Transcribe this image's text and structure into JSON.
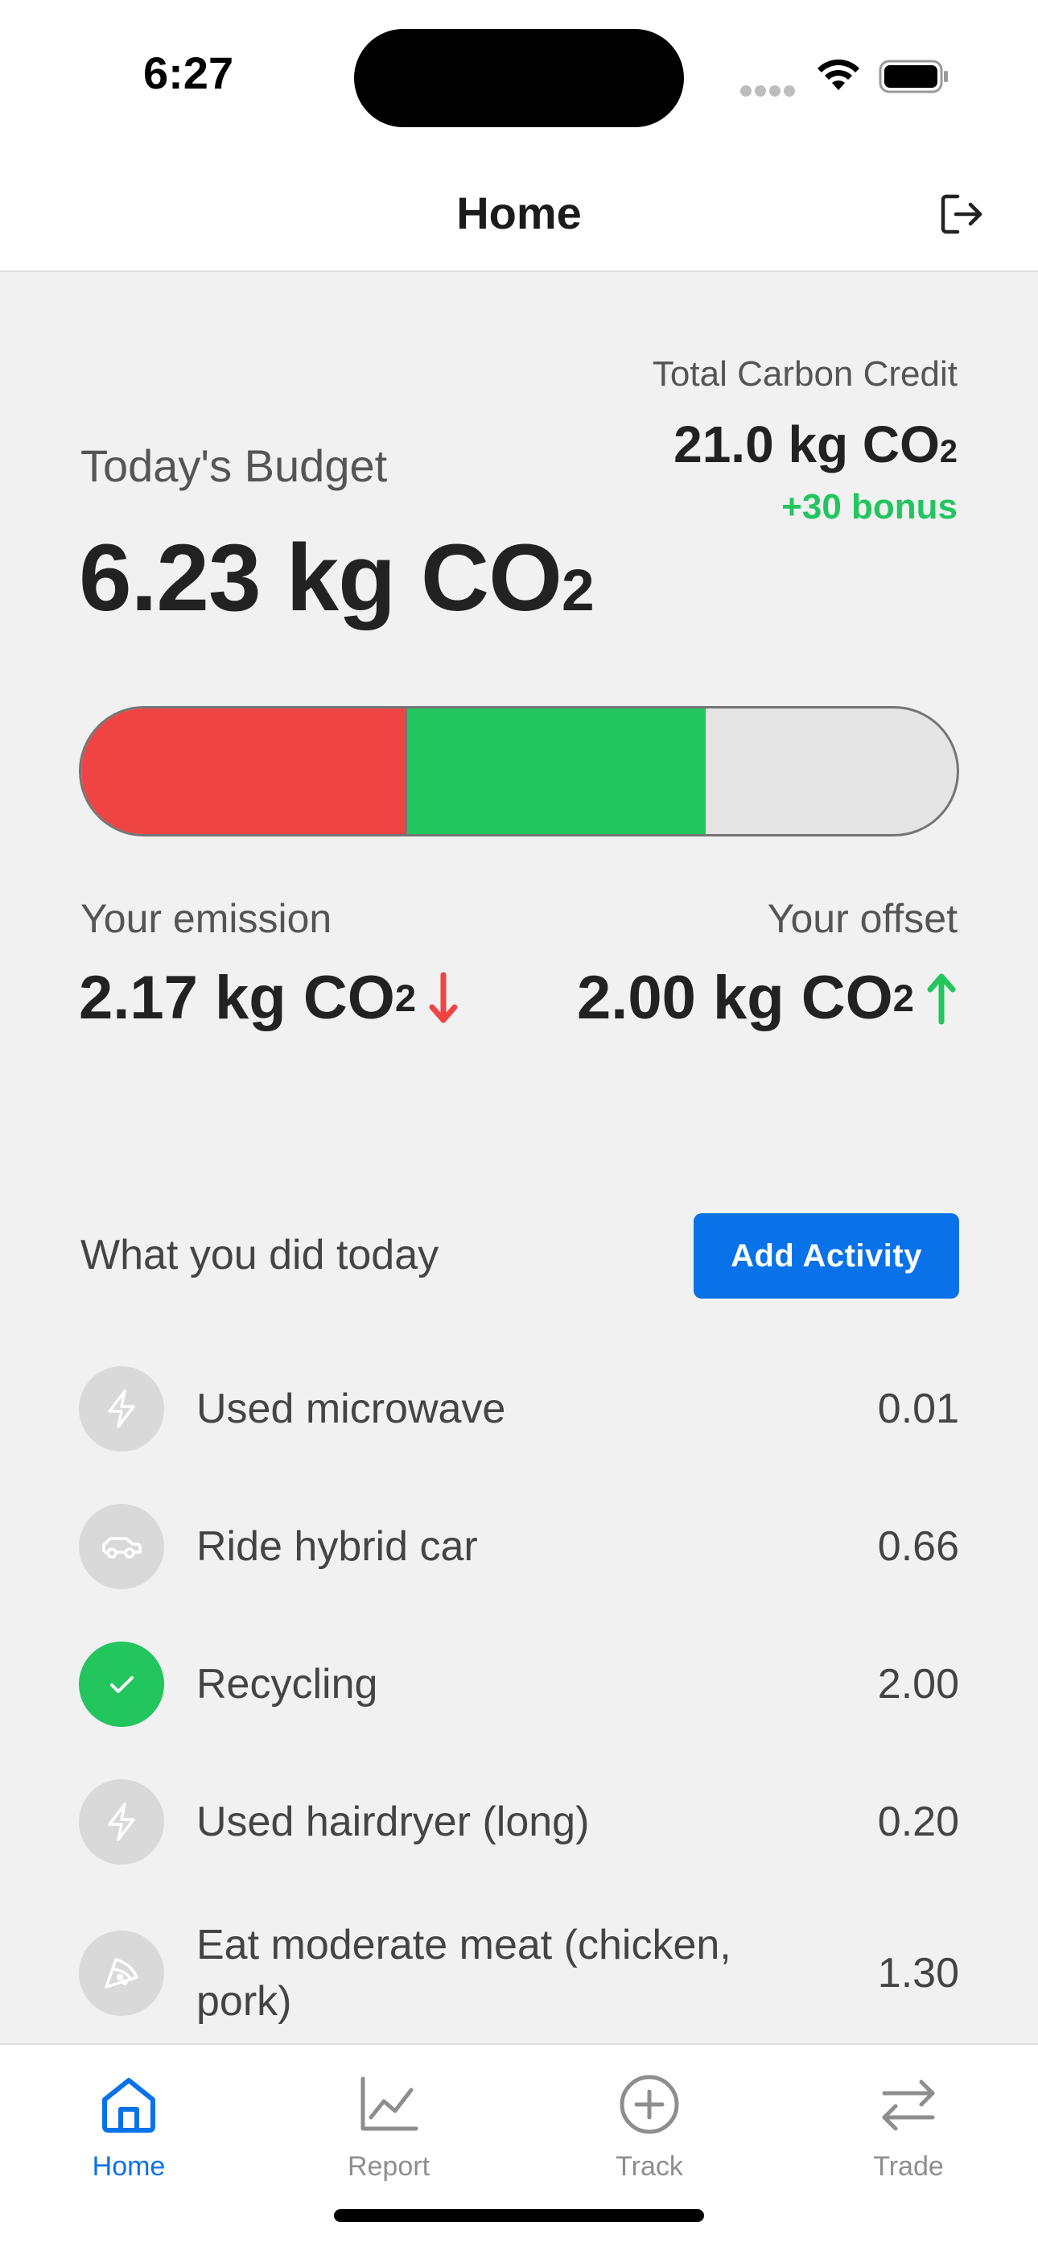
{
  "status_bar": {
    "time": "6:27"
  },
  "nav": {
    "title": "Home"
  },
  "credit": {
    "label": "Total Carbon Credit",
    "value": "21.0 kg CO",
    "subscript": "2",
    "bonus": "+30 bonus"
  },
  "budget": {
    "label": "Today's Budget",
    "value": "6.23 kg CO",
    "subscript": "2"
  },
  "budget_bar": {
    "emission_fraction": 0.372,
    "offset_fraction": 0.341,
    "colors": {
      "emission": "#ef4444",
      "offset": "#22c55e",
      "remaining": "#e5e5e5"
    }
  },
  "emission": {
    "label": "Your emission",
    "value": "2.17 kg CO",
    "subscript": "2",
    "arrow": "arrow-down-icon",
    "color": "#ef4444"
  },
  "offset": {
    "label": "Your offset",
    "value": "2.00 kg CO",
    "subscript": "2",
    "arrow": "arrow-up-icon",
    "color": "#22c55e"
  },
  "activities_section": {
    "title": "What you did today",
    "add_button": "Add Activity"
  },
  "activities": [
    {
      "name": "Used microwave",
      "value": "0.01",
      "icon": "lightning-icon"
    },
    {
      "name": "Ride hybrid car",
      "value": "0.66",
      "icon": "car-icon"
    },
    {
      "name": "Recycling",
      "value": "2.00",
      "icon": "check-icon"
    },
    {
      "name": "Used hairdryer (long)",
      "value": "0.20",
      "icon": "lightning-icon"
    },
    {
      "name": "Eat moderate meat (chicken, pork)",
      "value": "1.30",
      "icon": "pizza-icon"
    }
  ],
  "tabs": [
    {
      "label": "Home",
      "icon": "home-icon",
      "active": true
    },
    {
      "label": "Report",
      "icon": "chart-icon",
      "active": false
    },
    {
      "label": "Track",
      "icon": "plus-circle-icon",
      "active": false
    },
    {
      "label": "Trade",
      "icon": "arrows-icon",
      "active": false
    }
  ],
  "accent_color": "#0a72e8"
}
